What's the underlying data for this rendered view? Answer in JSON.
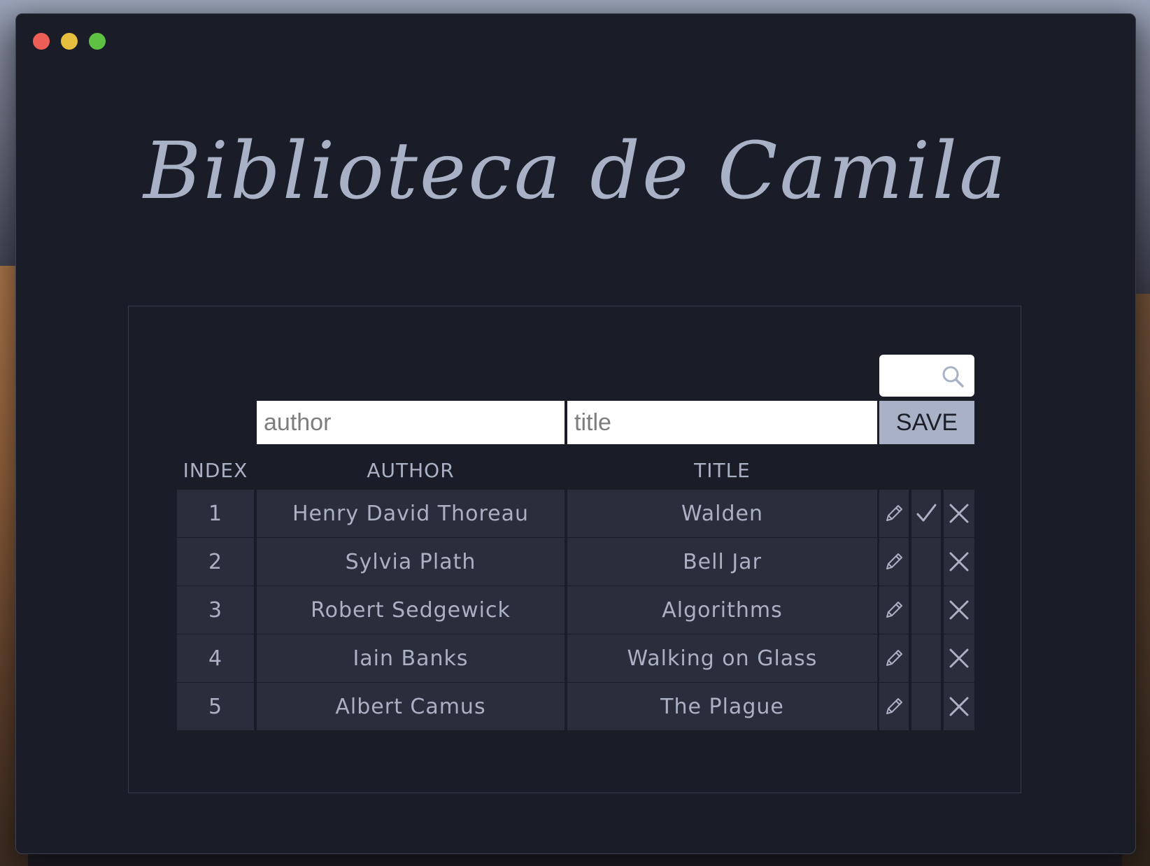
{
  "app": {
    "title": "Biblioteca de Camila"
  },
  "search": {
    "value": "",
    "icon": "search-icon"
  },
  "form": {
    "author_placeholder": "author",
    "title_placeholder": "title",
    "save_label": "SAVE"
  },
  "table": {
    "headers": {
      "index": "INDEX",
      "author": "AUTHOR",
      "title": "TITLE"
    },
    "rows": [
      {
        "index": "1",
        "author": "Henry David Thoreau",
        "title": "Walden",
        "checked": true
      },
      {
        "index": "2",
        "author": "Sylvia Plath",
        "title": "Bell Jar",
        "checked": false
      },
      {
        "index": "3",
        "author": "Robert Sedgewick",
        "title": "Algorithms",
        "checked": false
      },
      {
        "index": "4",
        "author": "Iain Banks",
        "title": "Walking on Glass",
        "checked": false
      },
      {
        "index": "5",
        "author": "Albert Camus",
        "title": "The Plague",
        "checked": false
      }
    ],
    "icons": {
      "edit": "pencil-icon",
      "check": "checkmark-icon",
      "delete": "close-icon"
    }
  },
  "colors": {
    "window_bg": "#1a1c27",
    "cell_bg": "#2a2d3c",
    "text": "#aab1c5",
    "save_bg": "#a9b1c7"
  }
}
